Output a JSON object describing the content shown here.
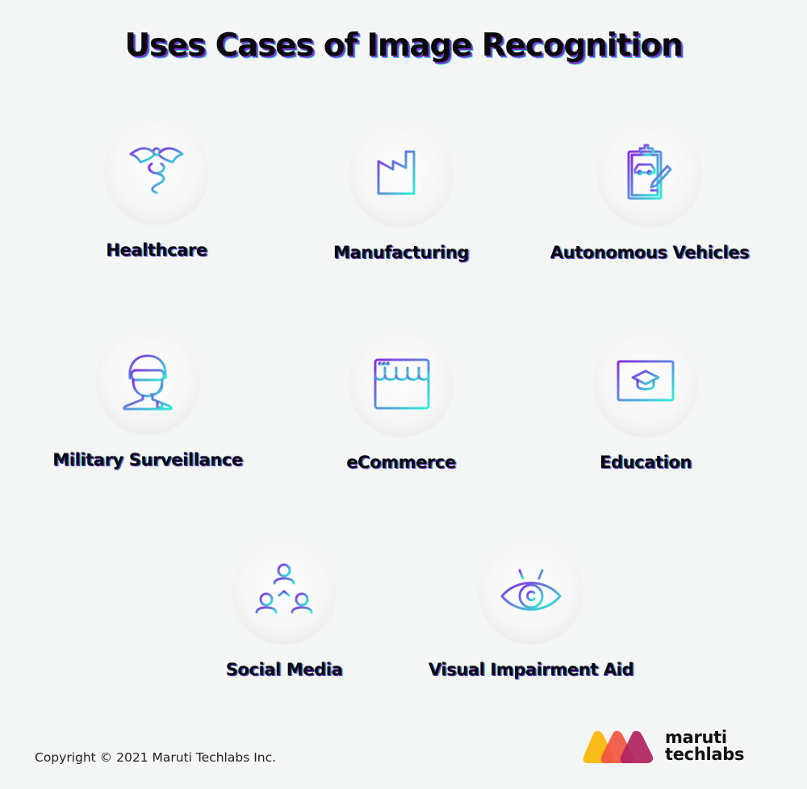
{
  "title": "Uses Cases of Image Recognition",
  "items": [
    {
      "label": "Healthcare",
      "icon": "caduceus-icon"
    },
    {
      "label": "Manufacturing",
      "icon": "factory-icon"
    },
    {
      "label": "Autonomous Vehicles",
      "icon": "clipboard-car-icon"
    },
    {
      "label": "Military Surveillance",
      "icon": "soldier-icon"
    },
    {
      "label": "eCommerce",
      "icon": "storefront-icon"
    },
    {
      "label": "Education",
      "icon": "monitor-graduation-cap-icon"
    },
    {
      "label": "Social Media",
      "icon": "social-network-icon"
    },
    {
      "label": "Visual Impairment Aid",
      "icon": "eye-icon"
    }
  ],
  "footer": {
    "copyright": "Copyright © 2021 Maruti Techlabs Inc.",
    "logo_line1": "maruti",
    "logo_line2": "techlabs"
  },
  "colors": {
    "gradient_start": "#8a2be2",
    "gradient_end": "#2ef2d6",
    "logo_yellow": "#fbbc1a",
    "logo_orange": "#f0553f",
    "logo_magenta": "#b0225e"
  }
}
